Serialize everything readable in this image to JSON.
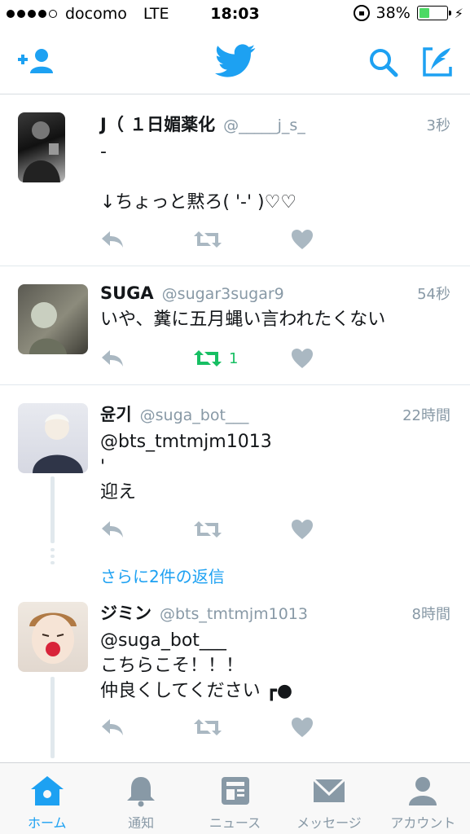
{
  "status_bar": {
    "carrier": "docomo",
    "network": "LTE",
    "time": "18:03",
    "battery_percent": "38%",
    "battery_level": 0.38
  },
  "colors": {
    "accent": "#1da1f2",
    "retweet_active": "#17bf63",
    "muted": "#8899a6",
    "action_icon": "#aab8c2"
  },
  "nav": {
    "left_icon": "add-user-icon",
    "center_icon": "twitter-bird-icon",
    "right_icons": [
      "search-icon",
      "compose-icon"
    ]
  },
  "tweets": [
    {
      "name": "J（ １日媚薬化",
      "handle": "@_____j_s_",
      "time": "3秒",
      "text": "-\n\n↓ちょっと黙ろ( '-' )♡♡",
      "retweets": ""
    },
    {
      "name": "SUGA",
      "handle": "@sugar3sugar9",
      "time": "54秒",
      "text": "いや、糞に五月蝿い言われたくない",
      "retweets": "1"
    },
    {
      "name": "윤기",
      "handle": "@suga_bot___",
      "time": "22時間",
      "text": "@bts_tmtmjm1013\n'\n迎え",
      "retweets": ""
    },
    {
      "name": "ジミン",
      "handle": "@bts_tmtmjm1013",
      "time": "8時間",
      "text": "@suga_bot___\nこちらこそ！！！\n仲良くしてください ┏●",
      "retweets": ""
    }
  ],
  "more_replies": "さらに2件の返信",
  "tab_bar": {
    "tabs": [
      {
        "label": "ホーム",
        "icon": "home-icon",
        "active": true
      },
      {
        "label": "通知",
        "icon": "bell-icon",
        "active": false
      },
      {
        "label": "ニュース",
        "icon": "news-icon",
        "active": false
      },
      {
        "label": "メッセージ",
        "icon": "envelope-icon",
        "active": false
      },
      {
        "label": "アカウント",
        "icon": "person-icon",
        "active": false
      }
    ]
  }
}
